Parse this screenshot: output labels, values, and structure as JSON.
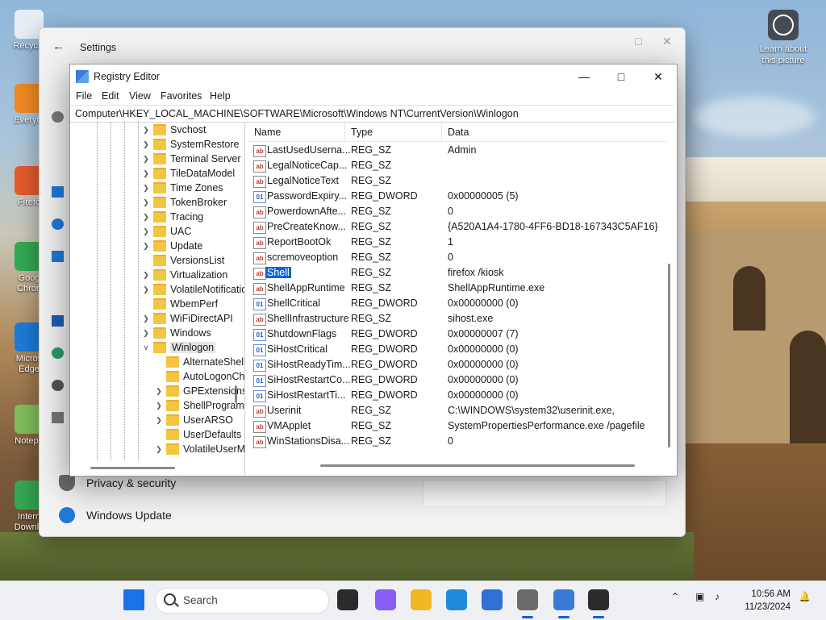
{
  "desktop": {
    "icons": [
      {
        "label": "Recycle",
        "color": "#e8eef5"
      },
      {
        "label": "Everyth",
        "color": "#f08a24"
      },
      {
        "label": "Firefo",
        "color": "#e55b2d"
      },
      {
        "label": "Goog\nChron",
        "color": "#34a853"
      },
      {
        "label": "Micros\nEdge",
        "color": "#1f7ad9"
      },
      {
        "label": "Notepa",
        "color": "#7fbf5a"
      },
      {
        "label": "Intern\nDownlo",
        "color": "#36a852"
      }
    ],
    "learn_about": "Learn about this picture"
  },
  "settings": {
    "title": "Settings",
    "items": [
      {
        "label": "Privacy & security",
        "icon": "shield-icon",
        "color": "#6b6b6b"
      },
      {
        "label": "Windows Update",
        "icon": "update-icon",
        "color": "#1f7ad9"
      }
    ]
  },
  "regedit": {
    "title": "Registry Editor",
    "menu": [
      "File",
      "Edit",
      "View",
      "Favorites",
      "Help"
    ],
    "address": "Computer\\HKEY_LOCAL_MACHINE\\SOFTWARE\\Microsoft\\Windows NT\\CurrentVersion\\Winlogon",
    "tree": [
      {
        "label": "Svchost",
        "level": 0,
        "expand": "closed"
      },
      {
        "label": "SystemRestore",
        "level": 0,
        "expand": "closed"
      },
      {
        "label": "Terminal Server",
        "level": 0,
        "expand": "closed"
      },
      {
        "label": "TileDataModel",
        "level": 0,
        "expand": "closed"
      },
      {
        "label": "Time Zones",
        "level": 0,
        "expand": "closed"
      },
      {
        "label": "TokenBroker",
        "level": 0,
        "expand": "closed"
      },
      {
        "label": "Tracing",
        "level": 0,
        "expand": "closed"
      },
      {
        "label": "UAC",
        "level": 0,
        "expand": "closed"
      },
      {
        "label": "Update",
        "level": 0,
        "expand": "closed"
      },
      {
        "label": "VersionsList",
        "level": 0,
        "expand": "none"
      },
      {
        "label": "Virtualization",
        "level": 0,
        "expand": "closed"
      },
      {
        "label": "VolatileNotifications",
        "level": 0,
        "expand": "closed"
      },
      {
        "label": "WbemPerf",
        "level": 0,
        "expand": "none"
      },
      {
        "label": "WiFiDirectAPI",
        "level": 0,
        "expand": "closed"
      },
      {
        "label": "Windows",
        "level": 0,
        "expand": "closed"
      },
      {
        "label": "Winlogon",
        "level": 0,
        "expand": "open",
        "selected": true
      },
      {
        "label": "AlternateShells",
        "level": 1,
        "expand": "none"
      },
      {
        "label": "AutoLogonChecked",
        "level": 1,
        "expand": "none"
      },
      {
        "label": "GPExtensions",
        "level": 1,
        "expand": "closed"
      },
      {
        "label": "ShellPrograms",
        "level": 1,
        "expand": "closed"
      },
      {
        "label": "UserARSO",
        "level": 1,
        "expand": "closed"
      },
      {
        "label": "UserDefaults",
        "level": 1,
        "expand": "none"
      },
      {
        "label": "VolatileUserMgrKey",
        "level": 1,
        "expand": "closed"
      }
    ],
    "columns": [
      "Name",
      "Type",
      "Data"
    ],
    "values": [
      {
        "name": "LastUsedUserna...",
        "type": "REG_SZ",
        "data": "Admin",
        "kind": "ab"
      },
      {
        "name": "LegalNoticeCap...",
        "type": "REG_SZ",
        "data": "",
        "kind": "ab"
      },
      {
        "name": "LegalNoticeText",
        "type": "REG_SZ",
        "data": "",
        "kind": "ab"
      },
      {
        "name": "PasswordExpiry...",
        "type": "REG_DWORD",
        "data": "0x00000005 (5)",
        "kind": "bin"
      },
      {
        "name": "PowerdownAfte...",
        "type": "REG_SZ",
        "data": "0",
        "kind": "ab"
      },
      {
        "name": "PreCreateKnow...",
        "type": "REG_SZ",
        "data": "{A520A1A4-1780-4FF6-BD18-167343C5AF16}",
        "kind": "ab"
      },
      {
        "name": "ReportBootOk",
        "type": "REG_SZ",
        "data": "1",
        "kind": "ab"
      },
      {
        "name": "scremoveoption",
        "type": "REG_SZ",
        "data": "0",
        "kind": "ab"
      },
      {
        "name": "Shell",
        "type": "REG_SZ",
        "data": "firefox /kiosk",
        "kind": "ab",
        "selected": true
      },
      {
        "name": "ShellAppRuntime",
        "type": "REG_SZ",
        "data": "ShellAppRuntime.exe",
        "kind": "ab"
      },
      {
        "name": "ShellCritical",
        "type": "REG_DWORD",
        "data": "0x00000000 (0)",
        "kind": "bin"
      },
      {
        "name": "ShellInfrastructure",
        "type": "REG_SZ",
        "data": "sihost.exe",
        "kind": "ab"
      },
      {
        "name": "ShutdownFlags",
        "type": "REG_DWORD",
        "data": "0x00000007 (7)",
        "kind": "bin"
      },
      {
        "name": "SiHostCritical",
        "type": "REG_DWORD",
        "data": "0x00000000 (0)",
        "kind": "bin"
      },
      {
        "name": "SiHostReadyTim...",
        "type": "REG_DWORD",
        "data": "0x00000000 (0)",
        "kind": "bin"
      },
      {
        "name": "SiHostRestartCo...",
        "type": "REG_DWORD",
        "data": "0x00000000 (0)",
        "kind": "bin"
      },
      {
        "name": "SiHostRestartTi...",
        "type": "REG_DWORD",
        "data": "0x00000000 (0)",
        "kind": "bin"
      },
      {
        "name": "Userinit",
        "type": "REG_SZ",
        "data": "C:\\WINDOWS\\system32\\userinit.exe,",
        "kind": "ab"
      },
      {
        "name": "VMApplet",
        "type": "REG_SZ",
        "data": "SystemPropertiesPerformance.exe /pagefile",
        "kind": "ab"
      },
      {
        "name": "WinStationsDisa...",
        "type": "REG_SZ",
        "data": "0",
        "kind": "ab"
      }
    ]
  },
  "taskbar": {
    "search_placeholder": "Search",
    "apps": [
      {
        "name": "start-icon",
        "color": "#1a73e8"
      },
      {
        "name": "task-view-icon",
        "color": "#2b2b2b"
      },
      {
        "name": "copilot-icon",
        "color": "#8a5cf6"
      },
      {
        "name": "file-explorer-icon",
        "color": "#f2b824"
      },
      {
        "name": "edge-icon",
        "color": "#1f8ad9"
      },
      {
        "name": "store-icon",
        "color": "#2f6fd6"
      },
      {
        "name": "settings-icon",
        "color": "#6a6a6a"
      },
      {
        "name": "regedit-icon",
        "color": "#3a7bd5"
      },
      {
        "name": "terminal-icon",
        "color": "#2b2b2b"
      }
    ],
    "time": "10:56 AM",
    "date": "11/23/2024"
  }
}
